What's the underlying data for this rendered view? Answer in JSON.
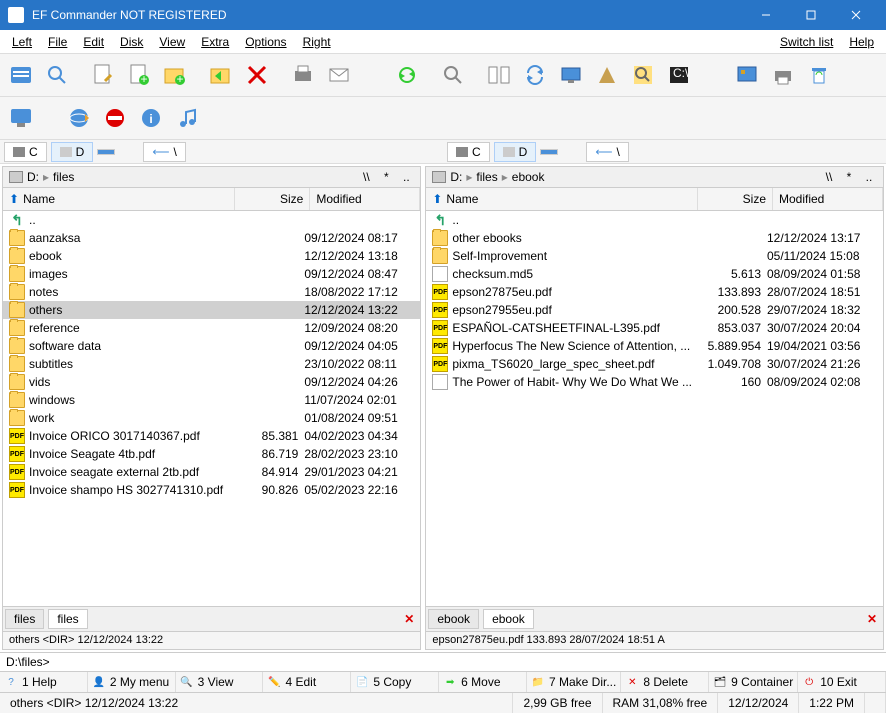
{
  "title": "EF Commander NOT REGISTERED",
  "menu": {
    "left": "Left",
    "file": "File",
    "edit": "Edit",
    "disk": "Disk",
    "view": "View",
    "extra": "Extra",
    "options": "Options",
    "right": "Right",
    "switch": "Switch list",
    "help": "Help"
  },
  "drives": {
    "c": "C",
    "d": "D"
  },
  "cols": {
    "name": "Name",
    "size": "Size",
    "mod": "Modified"
  },
  "left_panel": {
    "path_drive": "D:",
    "path_p1": "files",
    "updir": "<UP-DIR>",
    "nav_back": "\\\\",
    "nav_star": "*",
    "nav_dots": "..",
    "rows": [
      {
        "n": "..",
        "s": "<UP-DIR>",
        "m": "",
        "t": "up"
      },
      {
        "n": "aanzaksa",
        "s": "<DIR>",
        "m": "09/12/2024  08:17",
        "t": "folder"
      },
      {
        "n": "ebook",
        "s": "<DIR>",
        "m": "12/12/2024  13:18",
        "t": "folder"
      },
      {
        "n": "images",
        "s": "<DIR>",
        "m": "09/12/2024  08:47",
        "t": "folder"
      },
      {
        "n": "notes",
        "s": "<DIR>",
        "m": "18/08/2022  17:12",
        "t": "folder"
      },
      {
        "n": "others",
        "s": "<DIR>",
        "m": "12/12/2024  13:22",
        "t": "folder",
        "sel": true
      },
      {
        "n": "reference",
        "s": "<DIR>",
        "m": "12/09/2024  08:20",
        "t": "folder"
      },
      {
        "n": "software data",
        "s": "<DIR>",
        "m": "09/12/2024  04:05",
        "t": "folder"
      },
      {
        "n": "subtitles",
        "s": "<DIR>",
        "m": "23/10/2022  08:11",
        "t": "folder"
      },
      {
        "n": "vids",
        "s": "<DIR>",
        "m": "09/12/2024  04:26",
        "t": "folder"
      },
      {
        "n": "windows",
        "s": "<DIR>",
        "m": "11/07/2024  02:01",
        "t": "folder"
      },
      {
        "n": "work",
        "s": "<DIR>",
        "m": "01/08/2024  09:51",
        "t": "folder"
      },
      {
        "n": "Invoice ORICO 3017140367.pdf",
        "s": "85.381",
        "m": "04/02/2023  04:34",
        "t": "pdf"
      },
      {
        "n": "Invoice Seagate 4tb.pdf",
        "s": "86.719",
        "m": "28/02/2023  23:10",
        "t": "pdf"
      },
      {
        "n": "Invoice seagate external 2tb.pdf",
        "s": "84.914",
        "m": "29/01/2023  04:21",
        "t": "pdf"
      },
      {
        "n": "Invoice shampo HS 3027741310.pdf",
        "s": "90.826",
        "m": "05/02/2023  22:16",
        "t": "pdf"
      }
    ],
    "tab1": "files",
    "tab2": "files",
    "status": "others   <DIR>  12/12/2024  13:22"
  },
  "right_panel": {
    "path_drive": "D:",
    "path_p1": "files",
    "path_p2": "ebook",
    "updir": "<UP-DIR>",
    "nav_back": "\\\\",
    "nav_star": "*",
    "nav_dots": "..",
    "rows": [
      {
        "n": "..",
        "s": "<UP-DIR>",
        "m": "",
        "t": "up"
      },
      {
        "n": "other ebooks",
        "s": "<DIR>",
        "m": "12/12/2024  13:17",
        "t": "folder"
      },
      {
        "n": "Self-Improvement",
        "s": "<DIR>",
        "m": "05/11/2024  15:08",
        "t": "folder"
      },
      {
        "n": "checksum.md5",
        "s": "5.613",
        "m": "08/09/2024  01:58",
        "t": "file"
      },
      {
        "n": "epson27875eu.pdf",
        "s": "133.893",
        "m": "28/07/2024  18:51",
        "t": "pdf"
      },
      {
        "n": "epson27955eu.pdf",
        "s": "200.528",
        "m": "29/07/2024  18:32",
        "t": "pdf"
      },
      {
        "n": "ESPAÑOL-CATSHEETFINAL-L395.pdf",
        "s": "853.037",
        "m": "30/07/2024  20:04",
        "t": "pdf"
      },
      {
        "n": "Hyperfocus The New Science of Attention, ...",
        "s": "5.889.954",
        "m": "19/04/2021  03:56",
        "t": "pdf"
      },
      {
        "n": "pixma_TS6020_large_spec_sheet.pdf",
        "s": "1.049.708",
        "m": "30/07/2024  21:26",
        "t": "pdf"
      },
      {
        "n": "The Power of Habit- Why We Do What We ...",
        "s": "160",
        "m": "08/09/2024  02:08",
        "t": "file"
      }
    ],
    "tab1": "ebook",
    "tab2": "ebook",
    "status": "epson27875eu.pdf   133.893  28/07/2024  18:51  A"
  },
  "cmdline": {
    "prompt": "D:\\files>"
  },
  "fkeys": {
    "f1": "1 Help",
    "f2": "2 My menu",
    "f3": "3 View",
    "f4": "4 Edit",
    "f5": "5 Copy",
    "f6": "6 Move",
    "f7": "7 Make Dir...",
    "f8": "8 Delete",
    "f9": "9 Container",
    "f10": "10 Exit"
  },
  "status": {
    "s1": "others   <DIR>  12/12/2024  13:22",
    "s2": "2,99 GB free",
    "s3": "RAM 31,08% free",
    "s4": "12/12/2024",
    "s5": "1:22 PM"
  }
}
